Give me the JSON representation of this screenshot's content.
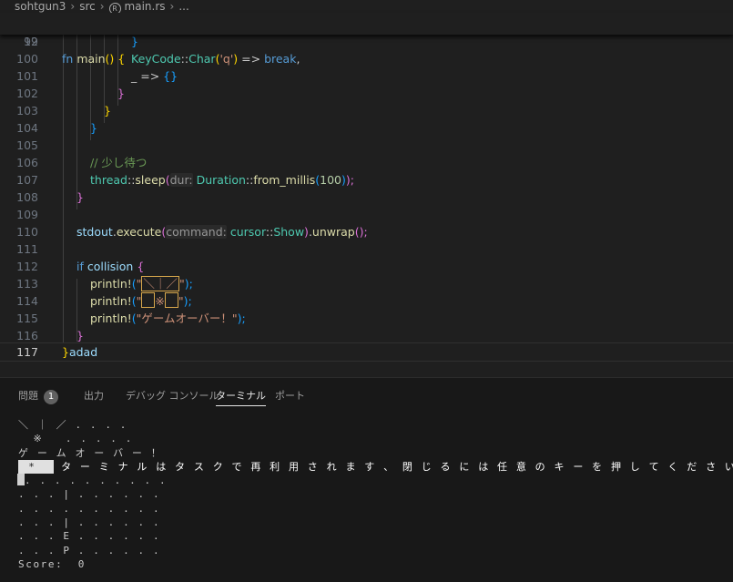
{
  "breadcrumb": {
    "folder": "sohtgun3",
    "sub": "src",
    "file": "main.rs",
    "more": "...",
    "icon": "rust-file-icon"
  },
  "sticky": {
    "line": "12",
    "code_kw": "fn",
    "code_name": "main",
    "code_rest": "() {"
  },
  "code": {
    "l99": "99",
    "l100": "100",
    "l101": "101",
    "l102": "102",
    "l103": "103",
    "l104": "104",
    "l105": "105",
    "l106": "106",
    "l107": "107",
    "l108": "108",
    "l109": "109",
    "l110": "110",
    "l111": "111",
    "l112": "112",
    "l113": "113",
    "l114": "114",
    "l115": "115",
    "l116": "116",
    "l117": "117",
    "c100_type": "KeyCode",
    "c100_sep": "::",
    "c100_fn": "Char",
    "c100_open": "(",
    "c100_str": "'q'",
    "c100_close": ")",
    "c100_arrow": " => ",
    "c100_kw": "break",
    "c100_end": ",",
    "c101_a": "_ => ",
    "c101_b": "{}",
    "c106": "// 少し待つ",
    "c107_type": "thread",
    "c107_sep": "::",
    "c107_fn": "sleep",
    "c107_open": "(",
    "c107_hint": "dur:",
    "c107_type2": "Duration",
    "c107_sep2": "::",
    "c107_fn2": "from_millis",
    "c107_open2": "(",
    "c107_num": "100",
    "c107_close": ")",
    "c107_end": ");",
    "c110_var": "stdout",
    "c110_dot": ".",
    "c110_fn": "execute",
    "c110_open": "(",
    "c110_hint": "command:",
    "c110_type": "cursor",
    "c110_sep": "::",
    "c110_type2": "Show",
    "c110_close": ")",
    "c110_dot2": ".",
    "c110_fn2": "unwrap",
    "c110_end": "();",
    "c112_kw": "if",
    "c112_var": "collision",
    "c112_b": "{",
    "c113_fn": "println!",
    "c113_open": "(",
    "c113_q1": "\"",
    "c113_q2": "\"",
    "c113_end": ");",
    "c114_fn": "println!",
    "c114_open": "(",
    "c114_q1": "\"",
    "c114_mid": "※",
    "c114_q2": "\"",
    "c114_end": ");",
    "c115_fn": "println!",
    "c115_open": "(",
    "c115_str": "\"ゲームオーバー！\"",
    "c115_end": ");",
    "c113_mid": "＼｜／",
    "c117_b": "}",
    "c117_text": "adad"
  },
  "panel": {
    "tabs": [
      {
        "label": "問題",
        "badge": "1"
      },
      {
        "label": "出力"
      },
      {
        "label": "デバッグ コンソール"
      },
      {
        "label": "ターミナル"
      },
      {
        "label": "ポート"
      }
    ],
    "active_tab": "ターミナル"
  },
  "terminal": {
    "lines": [
      "＼ ｜ ／ . . . .",
      "  ※   . . . . .",
      "ゲ ー ム オ ー バ ー ！",
      "",
      ". . . . . . . . . .",
      ". . . | . . . . . .",
      ". . . . . . . . . .",
      ". . . | . . . . . .",
      ". . . E . . . . . .",
      ". . . P . . . . . .",
      "Score:  0"
    ],
    "star": " *  ",
    "reuse_message": " タ ー ミ ナ ル は タ ス ク で 再 利 用 さ れ ま す 、 閉 じ る に は 任 意 の キ ー を 押 し て く だ さ い 。"
  },
  "colors": {
    "background": "#1f1f1f",
    "panel": "#181818",
    "keyword": "#569cd6",
    "string": "#ce9178",
    "type": "#4ec9b0"
  }
}
